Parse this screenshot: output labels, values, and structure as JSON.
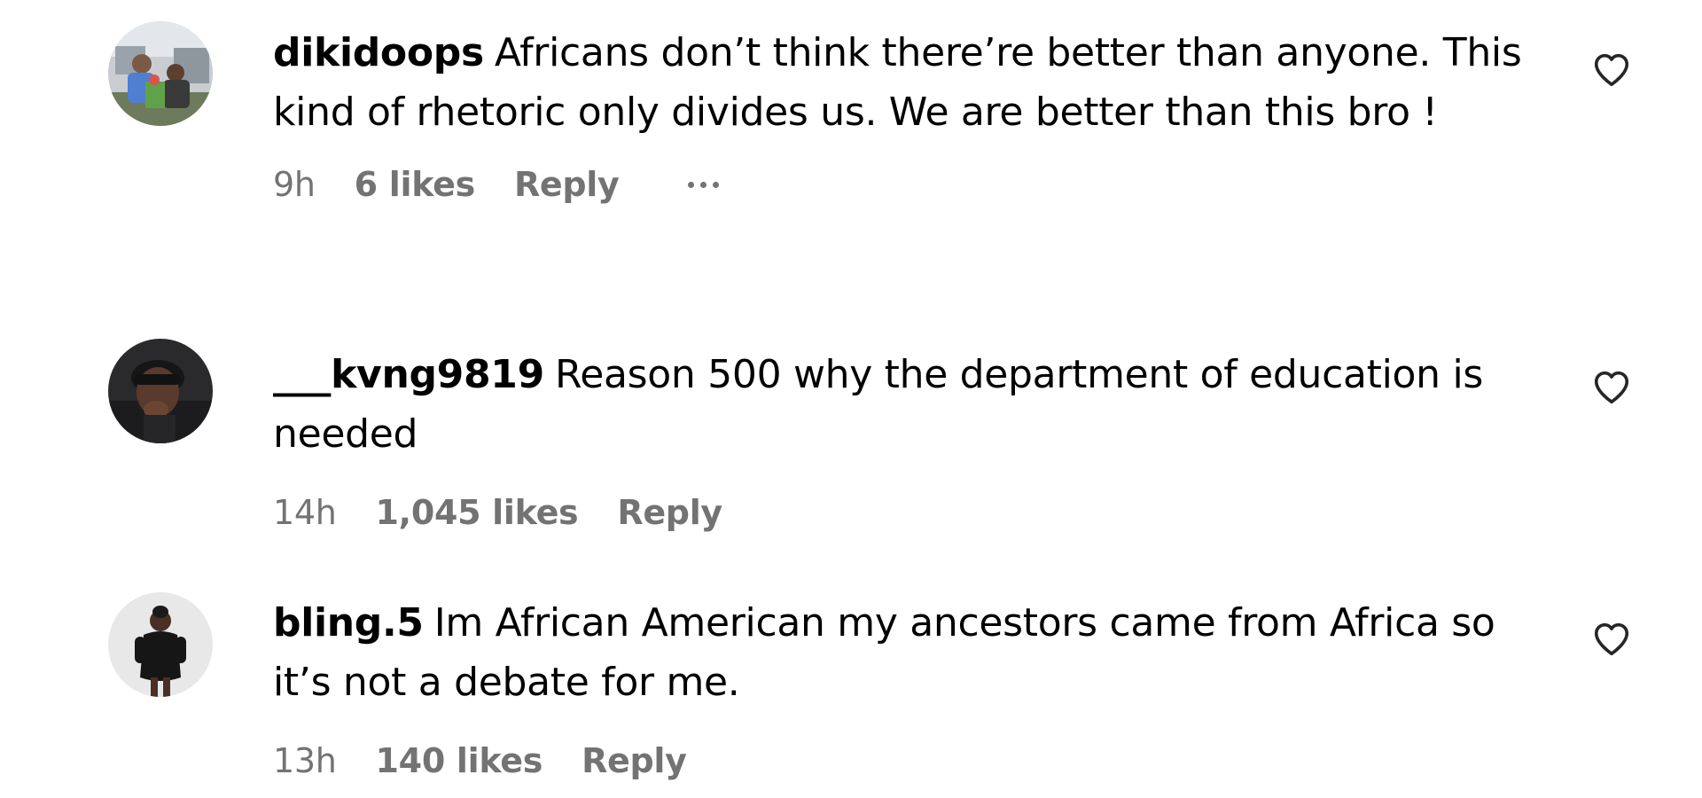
{
  "comments": [
    {
      "username": "dikidoops",
      "text": "Africans don’t think there’re better than anyone. This kind of rhetoric only divides us. We are better than this bro !",
      "time": "9h",
      "likes": "6 likes",
      "reply_label": "Reply",
      "has_more_menu": true,
      "avatar_icon": "family-photo-avatar"
    },
    {
      "username": "___kvng9819",
      "text": "Reason 500 why the department of education is needed",
      "time": "14h",
      "likes": "1,045 likes",
      "reply_label": "Reply",
      "has_more_menu": false,
      "avatar_icon": "person-portrait-avatar"
    },
    {
      "username": "bling.5",
      "text": "Im African American my ancestors came from Africa so it’s not a debate for me.",
      "time": "13h",
      "likes": "140 likes",
      "reply_label": "Reply",
      "has_more_menu": false,
      "avatar_icon": "person-full-body-avatar"
    }
  ],
  "icons": {
    "like": "heart-outline-icon",
    "more": "ellipsis-icon"
  },
  "colors": {
    "text": "#000000",
    "meta": "#737373",
    "background": "#ffffff"
  }
}
